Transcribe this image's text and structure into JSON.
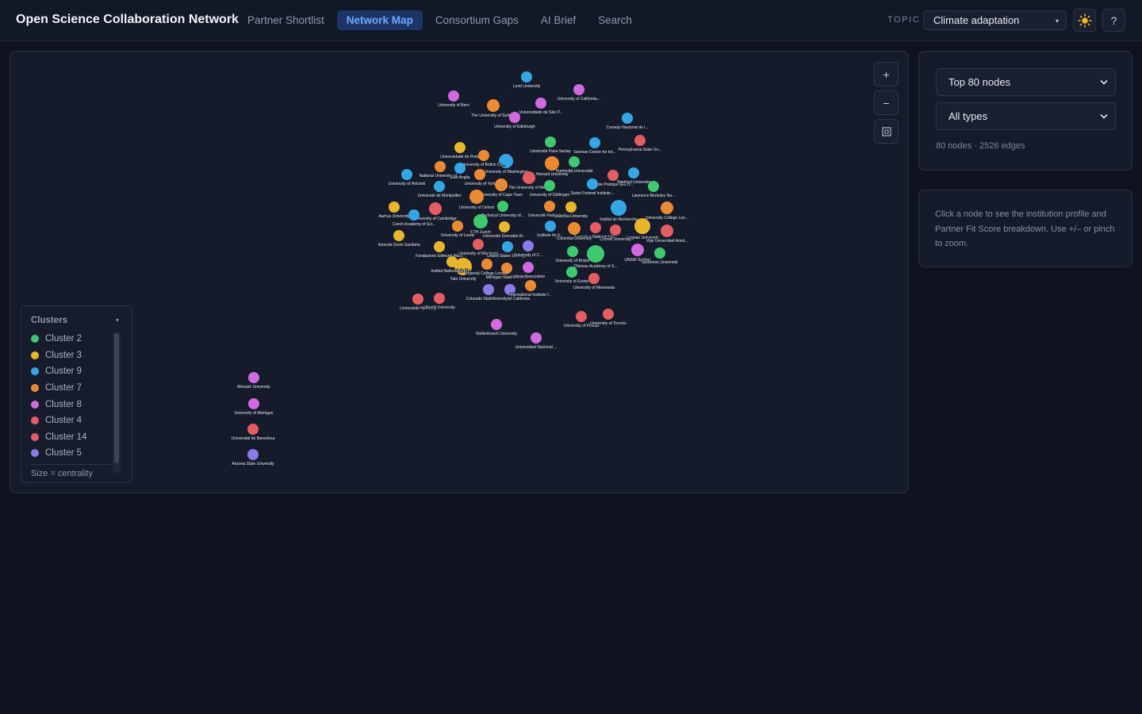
{
  "app": {
    "title": "Open Science Collaboration Network"
  },
  "nav": {
    "tabs": [
      {
        "label": "Partner Shortlist",
        "active": false
      },
      {
        "label": "Network Map",
        "active": true
      },
      {
        "label": "Consortium Gaps",
        "active": false
      },
      {
        "label": "AI Brief",
        "active": false
      },
      {
        "label": "Search",
        "active": false
      }
    ]
  },
  "topic": {
    "label": "TOPIC",
    "selected": "Climate adaptation"
  },
  "toolbar": {
    "theme_icon": "sun-icon",
    "help_label": "?"
  },
  "zoom": {
    "in_label": "+",
    "out_label": "−",
    "fit_label": "⊡"
  },
  "controls": {
    "node_limit_selected": "Top 80 nodes",
    "type_filter_selected": "All types",
    "stats": "80 nodes · 2526 edges"
  },
  "help": {
    "text": "Click a node to see the institution profile and Partner Fit Score breakdown. Use +/– or pinch to zoom."
  },
  "legend": {
    "title": "Clusters",
    "items": [
      {
        "label": "Cluster 2",
        "color": "#3ec96f"
      },
      {
        "label": "Cluster 3",
        "color": "#e8b62d"
      },
      {
        "label": "Cluster 9",
        "color": "#33a7e6"
      },
      {
        "label": "Cluster 7",
        "color": "#ec8a34"
      },
      {
        "label": "Cluster 8",
        "color": "#d169e0"
      },
      {
        "label": "Cluster 4",
        "color": "#e35d63"
      },
      {
        "label": "Cluster 14",
        "color": "#e35d63"
      },
      {
        "label": "Cluster 5",
        "color": "#8b7be8"
      }
    ],
    "footer": "Size = centrality"
  },
  "colors": {
    "cluster2": "#3ec96f",
    "cluster3": "#e8b62d",
    "cluster9": "#33a7e6",
    "cluster7": "#ec8a34",
    "cluster8": "#d169e0",
    "cluster4": "#e35d63",
    "cluster5": "#8b7be8",
    "accent": "#6ea7ff"
  },
  "graph": {
    "nodes": [
      {
        "label": "Lund University",
        "cluster": "cluster9"
      },
      {
        "label": "University of California...",
        "cluster": "cluster8"
      },
      {
        "label": "University of Bern",
        "cluster": "cluster8"
      },
      {
        "label": "Universidade de São P...",
        "cluster": "cluster8"
      },
      {
        "label": "The University of Sydney",
        "cluster": "cluster7"
      },
      {
        "label": "University of Edinburgh",
        "cluster": "cluster8"
      },
      {
        "label": "Consejo Nacional de I...",
        "cluster": "cluster9"
      },
      {
        "label": "Pennsylvania State Un...",
        "cluster": "cluster4"
      },
      {
        "label": "Université Paris-Saclay",
        "cluster": "cluster2"
      },
      {
        "label": "German Centre for Int...",
        "cluster": "cluster9"
      },
      {
        "label": "Universidade do Porto",
        "cluster": "cluster3"
      },
      {
        "label": "University of Washington",
        "cluster": "cluster9"
      },
      {
        "label": "Humboldt-Universität",
        "cluster": "cluster2"
      },
      {
        "label": "National University of ...",
        "cluster": "cluster7"
      },
      {
        "label": "University of British Co...",
        "cluster": "cluster7"
      },
      {
        "label": "Harvard University",
        "cluster": "cluster7"
      },
      {
        "label": "École Pratique des H...",
        "cluster": "cluster4"
      },
      {
        "label": "University of Helsinki",
        "cluster": "cluster9"
      },
      {
        "label": "East Anglia",
        "cluster": "cluster9"
      },
      {
        "label": "University of York",
        "cluster": "cluster7"
      },
      {
        "label": "The University of Mel...",
        "cluster": "cluster4"
      },
      {
        "label": "Stanford University",
        "cluster": "cluster9"
      },
      {
        "label": "Université de Montpellier",
        "cluster": "cluster9"
      },
      {
        "label": "University of Cape Town",
        "cluster": "cluster7"
      },
      {
        "label": "University of Göttingen",
        "cluster": "cluster2"
      },
      {
        "label": "Swiss Federal Institute...",
        "cluster": "cluster9"
      },
      {
        "label": "Lawrence Berkeley Na...",
        "cluster": "cluster2"
      },
      {
        "label": "University of Oxford",
        "cluster": "cluster7"
      },
      {
        "label": "Aarhus University",
        "cluster": "cluster3"
      },
      {
        "label": "University of Cambridge",
        "cluster": "cluster4"
      },
      {
        "label": "Technical University of...",
        "cluster": "cluster2"
      },
      {
        "label": "Université Fédérale de...",
        "cluster": "cluster7"
      },
      {
        "label": "Valencia University",
        "cluster": "cluster3"
      },
      {
        "label": "Institut de Recherche",
        "cluster": "cluster9"
      },
      {
        "label": "University College Lon...",
        "cluster": "cluster7"
      },
      {
        "label": "Czech Academy of Sci...",
        "cluster": "cluster9"
      },
      {
        "label": "ETH Zurich",
        "cluster": "cluster2"
      },
      {
        "label": "University of Leeds",
        "cluster": "cluster7"
      },
      {
        "label": "Université Grenoble Al...",
        "cluster": "cluster3"
      },
      {
        "label": "Institute for E...",
        "cluster": "cluster9"
      },
      {
        "label": "Australian National Uni...",
        "cluster": "cluster4"
      },
      {
        "label": "Lingnan University",
        "cluster": "cluster3"
      },
      {
        "label": "Vrije Universiteit Amst...",
        "cluster": "cluster4"
      },
      {
        "label": "Azienda Socio Sanitaria",
        "cluster": "cluster3"
      },
      {
        "label": "Columbia University",
        "cluster": "cluster7"
      },
      {
        "label": "Cornell University",
        "cluster": "cluster4"
      },
      {
        "label": "Fondazione Edmund Mach",
        "cluster": "cluster3"
      },
      {
        "label": "University of Maryland",
        "cluster": "cluster4"
      },
      {
        "label": "United States Geolog...",
        "cluster": "cluster9"
      },
      {
        "label": "University of C...",
        "cluster": "cluster5"
      },
      {
        "label": "University of Bristol",
        "cluster": "cluster2"
      },
      {
        "label": "UNSW Sydney",
        "cluster": "cluster8"
      },
      {
        "label": "Sorbonne Université",
        "cluster": "cluster2"
      },
      {
        "label": "Chinese Academy of S...",
        "cluster": "cluster2"
      },
      {
        "label": "Yale University",
        "cluster": "cluster3"
      },
      {
        "label": "Institut National de Re...",
        "cluster": "cluster3"
      },
      {
        "label": "Imperial College London",
        "cluster": "cluster7"
      },
      {
        "label": "Michigan State Univer...",
        "cluster": "cluster7"
      },
      {
        "label": "Leibniz Association",
        "cluster": "cluster8"
      },
      {
        "label": "University of Exeter",
        "cluster": "cluster2"
      },
      {
        "label": "University of Minnesota",
        "cluster": "cluster4"
      },
      {
        "label": "Colorado State University",
        "cluster": "cluster5"
      },
      {
        "label": "University of California",
        "cluster": "cluster5"
      },
      {
        "label": "International Institute f...",
        "cluster": "cluster7"
      },
      {
        "label": "Universität Hamburg",
        "cluster": "cluster4"
      },
      {
        "label": "Utrecht University",
        "cluster": "cluster4"
      },
      {
        "label": "University of Florida",
        "cluster": "cluster4"
      },
      {
        "label": "University of Toronto",
        "cluster": "cluster4"
      },
      {
        "label": "Stellenbosch University",
        "cluster": "cluster8"
      },
      {
        "label": "Universidad Nacional ...",
        "cluster": "cluster8"
      },
      {
        "label": "Monash University",
        "cluster": "cluster8"
      },
      {
        "label": "University of Michigan",
        "cluster": "cluster8"
      },
      {
        "label": "Universitat de Barcelona",
        "cluster": "cluster4"
      },
      {
        "label": "Arizona State University",
        "cluster": "cluster5"
      }
    ]
  }
}
